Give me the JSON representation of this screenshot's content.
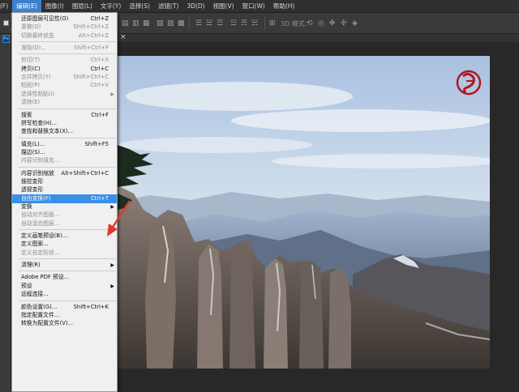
{
  "menubar": {
    "items": [
      "(F)",
      "编辑(E)",
      "图像(I)",
      "图层(L)",
      "文字(Y)",
      "选择(S)",
      "滤镜(T)",
      "3D(D)",
      "视图(V)",
      "窗口(W)",
      "帮助(H)"
    ],
    "active_index": 1
  },
  "options_bar": {
    "mode_label": "3D 模式："
  },
  "tab": {
    "close_glyph": "×"
  },
  "edit_menu": {
    "items": [
      {
        "label": "还原图层可见性(O)",
        "shortcut": "Ctrl+Z",
        "disabled": false
      },
      {
        "label": "重做(O)",
        "shortcut": "Shift+Ctrl+Z",
        "disabled": true
      },
      {
        "label": "切换最终状态",
        "shortcut": "Alt+Ctrl+Z",
        "disabled": true
      },
      {
        "sep": true
      },
      {
        "label": "渐隐(D)...",
        "shortcut": "Shift+Ctrl+F",
        "disabled": true
      },
      {
        "sep": true
      },
      {
        "label": "剪切(T)",
        "shortcut": "Ctrl+X",
        "disabled": true
      },
      {
        "label": "拷贝(C)",
        "shortcut": "Ctrl+C",
        "disabled": false
      },
      {
        "label": "合并拷贝(Y)",
        "shortcut": "Shift+Ctrl+C",
        "disabled": true
      },
      {
        "label": "粘贴(P)",
        "shortcut": "Ctrl+V",
        "disabled": true
      },
      {
        "label": "选择性粘贴(I)",
        "shortcut": "",
        "disabled": true,
        "submenu": true
      },
      {
        "label": "清除(E)",
        "shortcut": "",
        "disabled": true
      },
      {
        "sep": true
      },
      {
        "label": "搜索",
        "shortcut": "Ctrl+F",
        "disabled": false
      },
      {
        "label": "拼写检查(H)...",
        "shortcut": "",
        "disabled": false
      },
      {
        "label": "查找和替换文本(X)...",
        "shortcut": "",
        "disabled": false
      },
      {
        "sep": true
      },
      {
        "label": "填充(L)...",
        "shortcut": "Shift+F5",
        "disabled": false
      },
      {
        "label": "描边(S)...",
        "shortcut": "",
        "disabled": false
      },
      {
        "label": "内容识别填充...",
        "shortcut": "",
        "disabled": true
      },
      {
        "sep": true
      },
      {
        "label": "内容识别缩放",
        "shortcut": "Alt+Shift+Ctrl+C",
        "disabled": false
      },
      {
        "label": "操控变形",
        "shortcut": "",
        "disabled": false
      },
      {
        "label": "透视变形",
        "shortcut": "",
        "disabled": false
      },
      {
        "label": "自由变换(F)",
        "shortcut": "Ctrl+T",
        "disabled": false,
        "highlighted": true
      },
      {
        "label": "变换",
        "shortcut": "",
        "disabled": false,
        "submenu": true
      },
      {
        "label": "自动对齐图层...",
        "shortcut": "",
        "disabled": true
      },
      {
        "label": "自动混合图层...",
        "shortcut": "",
        "disabled": true
      },
      {
        "sep": true
      },
      {
        "label": "定义画笔预设(B)...",
        "shortcut": "",
        "disabled": false
      },
      {
        "label": "定义图案...",
        "shortcut": "",
        "disabled": false
      },
      {
        "label": "定义自定形状...",
        "shortcut": "",
        "disabled": true
      },
      {
        "sep": true
      },
      {
        "label": "清理(R)",
        "shortcut": "",
        "disabled": false,
        "submenu": true
      },
      {
        "sep": true
      },
      {
        "label": "Adobe PDF 预设...",
        "shortcut": "",
        "disabled": false
      },
      {
        "label": "预设",
        "shortcut": "",
        "disabled": false,
        "submenu": true
      },
      {
        "label": "远程连接...",
        "shortcut": "",
        "disabled": false
      },
      {
        "sep": true
      },
      {
        "label": "颜色设置(G)...",
        "shortcut": "Shift+Ctrl+K",
        "disabled": false
      },
      {
        "label": "指定配置文件...",
        "shortcut": "",
        "disabled": false
      },
      {
        "label": "转换为配置文件(V)...",
        "shortcut": "",
        "disabled": false
      }
    ]
  },
  "colors": {
    "menu_highlight": "#3a8fe6",
    "annotation_arrow": "#e03a2e",
    "seal_red": "#b4141e"
  }
}
